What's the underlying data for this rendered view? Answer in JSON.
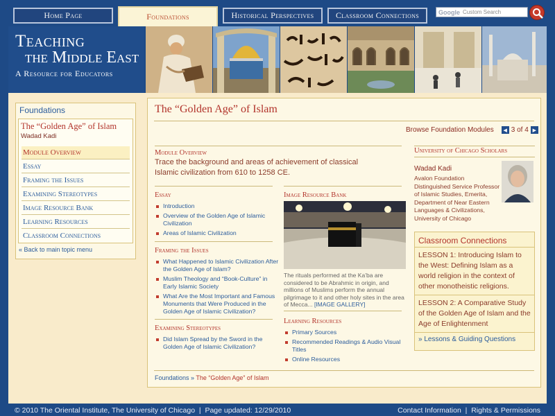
{
  "nav": {
    "tabs": [
      {
        "label": "Home Page"
      },
      {
        "label": "Foundations"
      },
      {
        "label": "Historical Perspectives"
      },
      {
        "label": "Classroom Connections"
      }
    ],
    "search": {
      "brand": "Google",
      "placeholder": "Custom Search"
    }
  },
  "logo": {
    "line1": "Teaching",
    "line2": "the Middle East",
    "line3": "A Resource for Educators"
  },
  "sidebar": {
    "header": "Foundations",
    "module_title": "The “Golden Age” of Islam",
    "author": "Wadad Kadi",
    "items": [
      {
        "label": "Module Overview"
      },
      {
        "label": "Essay"
      },
      {
        "label": "Framing the Issues"
      },
      {
        "label": "Examining Stereotypes"
      },
      {
        "label": "Image Resource Bank"
      },
      {
        "label": "Learning Resources"
      },
      {
        "label": "Classroom Connections"
      }
    ],
    "back_link": "« Back to main topic menu"
  },
  "main": {
    "title": "The “Golden Age” of Islam",
    "browse_label": "Browse Foundation Modules",
    "page_counter": "3 of 4",
    "overview_head": "Module Overview",
    "overview_text": "Trace the background and areas of achievement of classical Islamic civilization from 610 to 1258 CE.",
    "essay": {
      "head": "Essay",
      "links": [
        "Introduction",
        "Overview of the Golden Age of Islamic Civilization",
        "Areas of Islamic Civilization"
      ]
    },
    "framing": {
      "head": "Framing the Issues",
      "links": [
        "What Happened to Islamic Civilization After the Golden Age of Islam?",
        "Muslim Theology and “Book-Culture” in Early Islamic Society",
        "What Are the Most Important and Famous Monuments that Were Produced in the Golden Age of Islamic Civilization?"
      ]
    },
    "stereotypes": {
      "head": "Examining Stereotypes",
      "links": [
        "Did Islam Spread by the Sword in the Golden Age of Islamic Civilization?"
      ]
    },
    "image_bank": {
      "head": "Image Resource Bank",
      "caption": "The rituals performed at the Ka’ba are considered to be Abrahmic in origin, and millions of Muslims perform the annual pilgrimage to it and other holy sites in the area of Mecca...",
      "gallery_link": "[IMAGE GALLERY]"
    },
    "learning": {
      "head": "Learning Resources",
      "links": [
        "Primary Sources",
        "Recommended Readings & Audio Visual Titles",
        "Online Resources"
      ]
    },
    "scholars": {
      "head": "University of Chicago Scholars",
      "name": "Wadad Kadi",
      "bio": "Avalon Foundation Distinguished Service Professor of Islamic Studies, Emerita, Department of Near Eastern Languages & Civilizations, University of Chicago"
    },
    "classroom": {
      "title": "Classroom Connections",
      "lessons": [
        "LESSON 1: Introducing Islam to the West: Defining Islam as a world religion in the context of other monotheistic religions.",
        "LESSON 2: A Comparative Study of the Golden Age of Islam and the Age of Enlightenment"
      ],
      "guiding": "» Lessons & Guiding Questions"
    },
    "breadcrumb": {
      "root": "Foundations",
      "sep": " » ",
      "current": "The “Golden Age” of Islam"
    }
  },
  "footer": {
    "left": "© 2010 The Oriental Institute, The University of Chicago  |  Page updated: 12/29/2010",
    "contact": "Contact Information",
    "sep": "  |  ",
    "rights": "Rights & Permissions"
  },
  "colors": {
    "navy": "#1e4a86",
    "cream": "#f9ebcb",
    "accent_red": "#b2332b",
    "link_blue": "#2b5c9c"
  }
}
